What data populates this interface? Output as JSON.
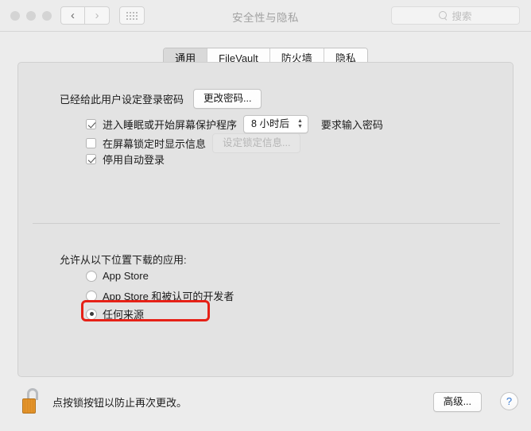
{
  "window": {
    "title": "安全性与隐私",
    "traffic_lights": [
      "close",
      "minimize",
      "zoom"
    ],
    "nav": {
      "back": "‹",
      "forward": "›"
    },
    "grid_button": "show-all",
    "search": {
      "placeholder": "搜索",
      "value": ""
    }
  },
  "tabs": [
    {
      "label": "通用",
      "active": true
    },
    {
      "label": "FileVault",
      "active": false
    },
    {
      "label": "防火墙",
      "active": false
    },
    {
      "label": "隐私",
      "active": false
    }
  ],
  "general": {
    "password_status": "已经给此用户设定登录密码",
    "change_password_button": "更改密码...",
    "options": [
      {
        "label": "进入睡眠或开始屏幕保护程序",
        "checked": true,
        "popup_value": "8 小时后",
        "suffix": "要求输入密码"
      },
      {
        "label": "在屏幕锁定时显示信息",
        "checked": false,
        "button_label": "设定锁定信息...",
        "button_disabled": true
      },
      {
        "label": "停用自动登录",
        "checked": true
      }
    ],
    "download_section": {
      "label": "允许从以下位置下载的应用:",
      "options": [
        {
          "label": "App Store",
          "selected": false
        },
        {
          "label": "App Store 和被认可的开发者",
          "selected": false
        },
        {
          "label": "任何来源",
          "selected": true,
          "highlighted": true
        }
      ],
      "highlight_color": "#e62117"
    }
  },
  "bottom": {
    "lock_icon": "unlocked-padlock-icon",
    "lock_message": "点按锁按钮以防止再次更改。",
    "advanced_button": "高级...",
    "help_button": "?"
  }
}
